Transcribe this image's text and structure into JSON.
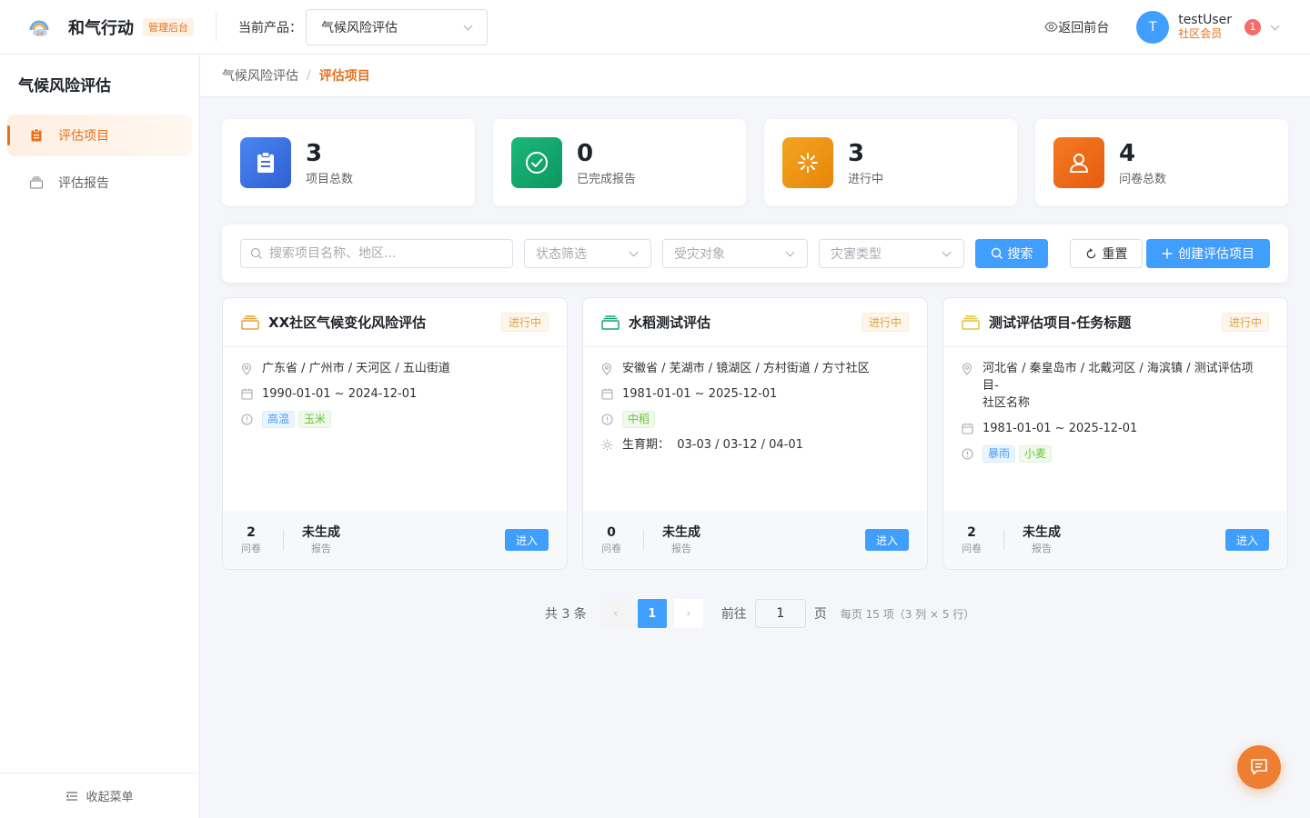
{
  "header": {
    "app_title": "和气行动",
    "admin_badge": "管理后台",
    "product_label": "当前产品：",
    "product_value": "气候风险评估",
    "back_link": "返回前台",
    "user_initial": "T",
    "user_name": "testUser",
    "user_role": "社区会员",
    "notification_count": "1"
  },
  "sidebar": {
    "title": "气候风险评估",
    "items": [
      {
        "label": "评估项目",
        "icon": "clipboard-icon",
        "active": true
      },
      {
        "label": "评估报告",
        "icon": "archive-icon",
        "active": false
      }
    ],
    "collapse_label": "收起菜单"
  },
  "breadcrumb": {
    "parent": "气候风险评估",
    "separator": "/",
    "current": "评估项目"
  },
  "stats": [
    {
      "value": "3",
      "label": "项目总数",
      "icon": "clipboard-icon",
      "color": "#3b6fe0"
    },
    {
      "value": "0",
      "label": "已完成报告",
      "icon": "check-circle-icon",
      "color": "#10a66b"
    },
    {
      "value": "3",
      "label": "进行中",
      "icon": "loading-icon",
      "color": "#ee9413"
    },
    {
      "value": "4",
      "label": "问卷总数",
      "icon": "user-icon",
      "color": "#ef6a16"
    }
  ],
  "filters": {
    "search_placeholder": "搜索项目名称、地区...",
    "status_placeholder": "状态筛选",
    "target_placeholder": "受灾对象",
    "hazard_placeholder": "灾害类型",
    "search_button": "搜索",
    "reset_button": "重置",
    "create_button": "创建评估项目"
  },
  "projects": [
    {
      "title": "XX社区气候变化风险评估",
      "status": "进行中",
      "icon_color": "#e6a23c",
      "location": "广东省 / 广州市 / 天河区 / 五山街道",
      "period": "1990-01-01 ~ 2024-12-01",
      "hazard_tag": "高温",
      "target_tag": "玉米",
      "questionnaires": "2",
      "questionnaires_label": "问卷",
      "report": "未生成",
      "report_label": "报告",
      "enter": "进入"
    },
    {
      "title": "水稻测试评估",
      "status": "进行中",
      "icon_color": "#10a66b",
      "location": "安徽省 / 芜湖市 / 镜湖区 / 方村街道 / 方寸社区",
      "period": "1981-01-01 ~ 2025-12-01",
      "target_tag": "中稻",
      "growth_period": "生育期：  03-03 / 03-12 / 04-01",
      "questionnaires": "0",
      "questionnaires_label": "问卷",
      "report": "未生成",
      "report_label": "报告",
      "enter": "进入"
    },
    {
      "title": "测试评估项目-任务标题",
      "status": "进行中",
      "icon_color": "#e6c23c",
      "location_line1": "河北省 / 秦皇岛市 / 北戴河区 / 海滨镇 / 测试评估项目-",
      "location_line2": "社区名称",
      "period": "1981-01-01 ~ 2025-12-01",
      "hazard_tag": "暴雨",
      "target_tag": "小麦",
      "questionnaires": "2",
      "questionnaires_label": "问卷",
      "report": "未生成",
      "report_label": "报告",
      "enter": "进入"
    }
  ],
  "pagination": {
    "total": "共 3 条",
    "current_page": "1",
    "goto_label": "前往",
    "goto_value": "1",
    "page_unit": "页",
    "per_page_note": "每页 15 项（3 列 × 5 行）"
  }
}
